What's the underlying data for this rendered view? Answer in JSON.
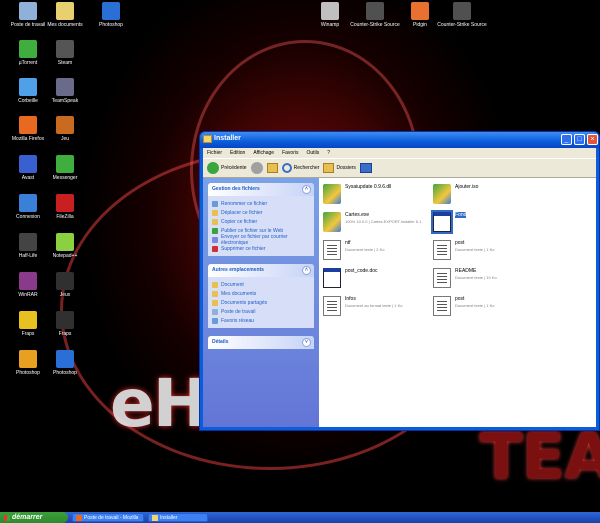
{
  "desktop": {
    "icons": [
      {
        "label": "Poste de travail",
        "color": "#8fb0d8"
      },
      {
        "label": "Mes documents",
        "color": "#e8d070"
      },
      {
        "label": "Photoshop",
        "color": "#2a6fd6"
      },
      {
        "label": "µTorrent",
        "color": "#3fae3f"
      },
      {
        "label": "Steam",
        "color": "#555555"
      },
      {
        "label": "Corbeille",
        "color": "#4fa0e8"
      },
      {
        "label": "TeamSpeak",
        "color": "#6a6a8a"
      },
      {
        "label": "Mozilla Firefox",
        "color": "#e86a20"
      },
      {
        "label": "Jeu",
        "color": "#c86a20"
      },
      {
        "label": "Avast",
        "color": "#3a5fd0"
      },
      {
        "label": "Messenger",
        "color": "#3fae3f"
      },
      {
        "label": "Connexion",
        "color": "#3a7fd8"
      },
      {
        "label": "FileZilla",
        "color": "#c82020"
      },
      {
        "label": "Half-Life",
        "color": "#444444"
      },
      {
        "label": "Notepad++",
        "color": "#8ad040"
      },
      {
        "label": "WinRAR",
        "color": "#8a3a8a"
      },
      {
        "label": "Jeux",
        "color": "#303030"
      },
      {
        "label": "Fraps",
        "color": "#e8c020"
      },
      {
        "label": "Fraps",
        "color": "#303030"
      },
      {
        "label": "Photoshop",
        "color": "#e8a020"
      },
      {
        "label": "Photoshop",
        "color": "#2a6fd6"
      }
    ],
    "top_icons": [
      {
        "label": "Winamp",
        "color": "#c0c0c0"
      },
      {
        "label": "Counter-Strike Source",
        "color": "#505050"
      },
      {
        "label": "Pidgin",
        "color": "#e87030"
      },
      {
        "label": "Counter-Strike Source",
        "color": "#505050"
      }
    ],
    "brand_text": "eHPOX",
    "team_text": "TEA"
  },
  "window": {
    "title": "Installer",
    "menu": [
      "Fichier",
      "Edition",
      "Affichage",
      "Favoris",
      "Outils",
      "?"
    ],
    "toolbar": {
      "back": "Précédente",
      "search": "Rechercher",
      "folders": "Dossiers"
    }
  },
  "taskpane": {
    "file_tasks": {
      "title": "Gestion des fichiers",
      "items": [
        {
          "label": "Renommer ce fichier",
          "color": "#6a9ad8"
        },
        {
          "label": "Déplacer ce fichier",
          "color": "#e8c050"
        },
        {
          "label": "Copier ce fichier",
          "color": "#e8c050"
        },
        {
          "label": "Publier ce fichier sur le Web",
          "color": "#3aa040"
        },
        {
          "label": "Envoyer ce fichier par courrier électronique",
          "color": "#7a8ad8"
        },
        {
          "label": "Supprimer ce fichier",
          "color": "#d03030"
        }
      ]
    },
    "other_places": {
      "title": "Autres emplacements",
      "items": [
        {
          "label": "Document",
          "color": "#e8c050"
        },
        {
          "label": "Mes documents",
          "color": "#e8c050"
        },
        {
          "label": "Documents partagés",
          "color": "#e8c050"
        },
        {
          "label": "Poste de travail",
          "color": "#8fb0d8"
        },
        {
          "label": "Favoris réseau",
          "color": "#6a9ad8"
        }
      ]
    },
    "details": {
      "title": "Détails"
    }
  },
  "files": [
    {
      "name": "Sysaiupdate 0.9.6.dll",
      "detail": "",
      "type": "setup"
    },
    {
      "name": "Ajouter.iso",
      "detail": "",
      "type": "setup"
    },
    {
      "name": "Cartes.exe",
      "detail": "100% 10.0.0 | Cartes.EXPORT.Installer 5.1",
      "type": "setup"
    },
    {
      "name": "Fond",
      "detail": "",
      "type": "winimg",
      "selected": true
    },
    {
      "name": "ntf",
      "detail": "Document texte | 2 Ko",
      "type": "doc"
    },
    {
      "name": "post",
      "detail": "Document texte | 1 Ko",
      "type": "doc"
    },
    {
      "name": "post_code.doc",
      "detail": "",
      "type": "winimg"
    },
    {
      "name": "README",
      "detail": "Document texte | 10 Ko",
      "type": "doc"
    },
    {
      "name": "Infos",
      "detail": "Document au format texte | 1 Ko",
      "type": "doc"
    },
    {
      "name": "post",
      "detail": "Document texte | 1 Ko",
      "type": "doc"
    }
  ],
  "taskbar": {
    "start_label": "démarrer",
    "tasks": [
      "Poste de travail - Mozilla",
      "Installer"
    ]
  }
}
